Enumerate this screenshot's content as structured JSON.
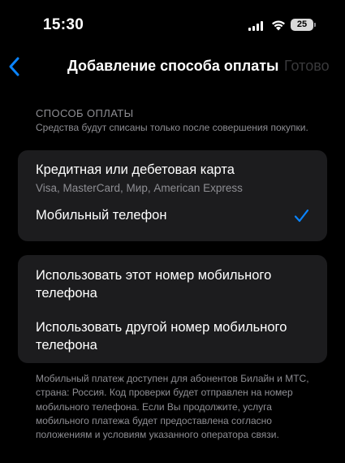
{
  "status_bar": {
    "time": "15:30",
    "battery": "25",
    "icons": [
      "signal-icon",
      "wifi-icon",
      "battery-icon"
    ]
  },
  "nav": {
    "back_icon": "chevron-left-icon",
    "title": "Добавление способа оплаты",
    "done_label": "Готово"
  },
  "section": {
    "title": "СПОСОБ ОПЛАТЫ",
    "description": "Средства будут списаны только после совершения покупки."
  },
  "payment_methods": [
    {
      "title": "Кредитная или дебетовая карта",
      "subtitle": "Visa, MasterCard, Мир, American Express",
      "selected": false
    },
    {
      "title": "Мобильный телефон",
      "subtitle": "",
      "selected": true
    }
  ],
  "phone_options": [
    {
      "title": "Использовать этот номер мобильного телефона"
    },
    {
      "title": "Использовать другой номер мобильного телефона"
    }
  ],
  "footer": "Мобильный платеж доступен для абонентов Билайн и МТС, страна: Россия. Код проверки будет отправлен на номер мобильного телефона. Если Вы продолжите, услуга мобильного платежа будет предоставлена согласно положениям и условиям указанного оператора связи.",
  "colors": {
    "accent": "#0a84ff",
    "background": "#000000",
    "cell": "#1c1c1e",
    "secondary_text": "#8e8e93"
  }
}
